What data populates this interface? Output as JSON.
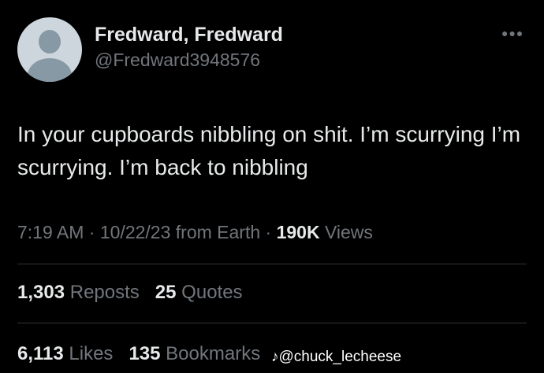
{
  "author": {
    "name": "Fredward, Fredward",
    "handle": "@Fredward3948576",
    "avatar_icon": "default-avatar-icon"
  },
  "more_icon": "ellipsis-icon",
  "tweet": {
    "text": "In your cupboards nibbling on shit. I’m scurrying I’m scurrying. I’m back to nibbling"
  },
  "meta": {
    "time": "7:19 AM",
    "sep1": "·",
    "date": "10/22/23",
    "source": "from Earth",
    "sep2": "·",
    "views_count": "190K",
    "views_label": "Views"
  },
  "stats": {
    "reposts_count": "1,303",
    "reposts_label": "Reposts",
    "quotes_count": "25",
    "quotes_label": "Quotes",
    "likes_count": "6,113",
    "likes_label": "Likes",
    "bookmarks_count": "135",
    "bookmarks_label": "Bookmarks"
  },
  "watermark": {
    "icon": "tiktok-icon",
    "text": "@chuck_lecheese"
  },
  "colors": {
    "background": "#000000",
    "primary_text": "#e7e9ea",
    "secondary_text": "#71767b",
    "divider": "#2f3336"
  }
}
